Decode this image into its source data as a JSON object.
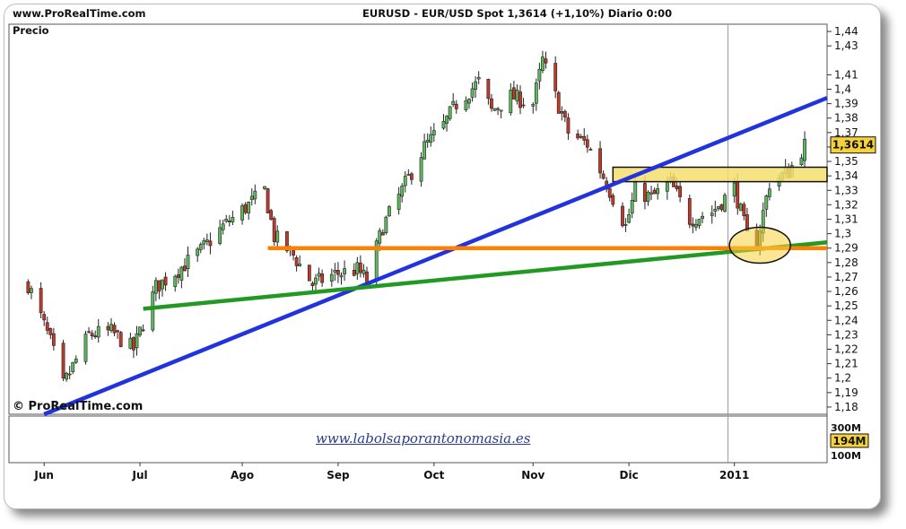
{
  "header": {
    "site": "www.ProRealTime.com",
    "title": "EURUSD - EUR/USD Spot    1,3614 (+1,10%)    Diario  0:00"
  },
  "panel_label": "Precio",
  "watermark": "© ProRealTime.com",
  "volume_panel": {
    "link_text": "www.labolsaporantonomasia.es",
    "tick_labels": [
      "300M",
      "194M",
      "100M"
    ],
    "current_value": "194M"
  },
  "colors": {
    "bull": "#5cb85c",
    "bear": "#c0392b",
    "blue_trend": "#2233dd",
    "green_trend": "#229922",
    "orange_support": "#ff8000",
    "resistance_zone": "#f5df6e",
    "highlight_circle": "#f5d23c"
  },
  "chart_data": {
    "type": "candlestick",
    "title": "EURUSD - EUR/USD Spot",
    "ylabel": "Precio",
    "ylim": [
      1.175,
      1.445
    ],
    "y_ticks": [
      "1,18",
      "1,19",
      "1,2",
      "1,21",
      "1,22",
      "1,23",
      "1,24",
      "1,25",
      "1,26",
      "1,27",
      "1,28",
      "1,29",
      "1,3",
      "1,31",
      "1,32",
      "1,33",
      "1,34",
      "1,35",
      "1,36",
      "1,37",
      "1,38",
      "1,39",
      "1,4",
      "1,41",
      "1,43",
      "1,44"
    ],
    "x_labels": [
      "Jun",
      "Jul",
      "Ago",
      "Sep",
      "Oct",
      "Nov",
      "Dic",
      "2011"
    ],
    "last_price": "1,3614",
    "anchors": [
      [
        "2010-05-27",
        1.265
      ],
      [
        "2010-06-03",
        1.225
      ],
      [
        "2010-06-07",
        1.195
      ],
      [
        "2010-06-15",
        1.23
      ],
      [
        "2010-06-22",
        1.232
      ],
      [
        "2010-06-29",
        1.22
      ],
      [
        "2010-07-06",
        1.263
      ],
      [
        "2010-07-13",
        1.275
      ],
      [
        "2010-07-20",
        1.288
      ],
      [
        "2010-07-27",
        1.305
      ],
      [
        "2010-08-04",
        1.32
      ],
      [
        "2010-08-09",
        1.33
      ],
      [
        "2010-08-12",
        1.298
      ],
      [
        "2010-08-18",
        1.285
      ],
      [
        "2010-08-24",
        1.265
      ],
      [
        "2010-08-31",
        1.272
      ],
      [
        "2010-09-07",
        1.275
      ],
      [
        "2010-09-10",
        1.268
      ],
      [
        "2010-09-15",
        1.305
      ],
      [
        "2010-09-21",
        1.33
      ],
      [
        "2010-09-28",
        1.36
      ],
      [
        "2010-10-04",
        1.375
      ],
      [
        "2010-10-08",
        1.39
      ],
      [
        "2010-10-15",
        1.405
      ],
      [
        "2010-10-19",
        1.385
      ],
      [
        "2010-10-25",
        1.395
      ],
      [
        "2010-11-01",
        1.39
      ],
      [
        "2010-11-04",
        1.42
      ],
      [
        "2010-11-08",
        1.395
      ],
      [
        "2010-11-12",
        1.37
      ],
      [
        "2010-11-18",
        1.362
      ],
      [
        "2010-11-24",
        1.335
      ],
      [
        "2010-11-30",
        1.305
      ],
      [
        "2010-12-03",
        1.33
      ],
      [
        "2010-12-08",
        1.325
      ],
      [
        "2010-12-14",
        1.335
      ],
      [
        "2010-12-20",
        1.31
      ],
      [
        "2010-12-27",
        1.315
      ],
      [
        "2011-01-03",
        1.332
      ],
      [
        "2011-01-07",
        1.298
      ],
      [
        "2011-01-10",
        1.294
      ],
      [
        "2011-01-14",
        1.335
      ],
      [
        "2011-01-20",
        1.343
      ],
      [
        "2011-01-25",
        1.3614
      ]
    ],
    "lines": [
      {
        "name": "blue trendline",
        "points": [
          [
            "2010-06-01",
            1.175
          ],
          [
            "2011-02-02",
            1.394
          ]
        ]
      },
      {
        "name": "green trendline",
        "points": [
          [
            "2010-07-02",
            1.248
          ],
          [
            "2011-02-02",
            1.294
          ]
        ]
      },
      {
        "name": "orange support",
        "points": [
          [
            "2010-08-10",
            1.29
          ],
          [
            "2011-02-02",
            1.29
          ]
        ]
      }
    ],
    "zones": [
      {
        "name": "resistance zone",
        "from": [
          "2010-11-26",
          1.336
        ],
        "to": [
          "2011-02-02",
          1.346
        ]
      }
    ]
  }
}
